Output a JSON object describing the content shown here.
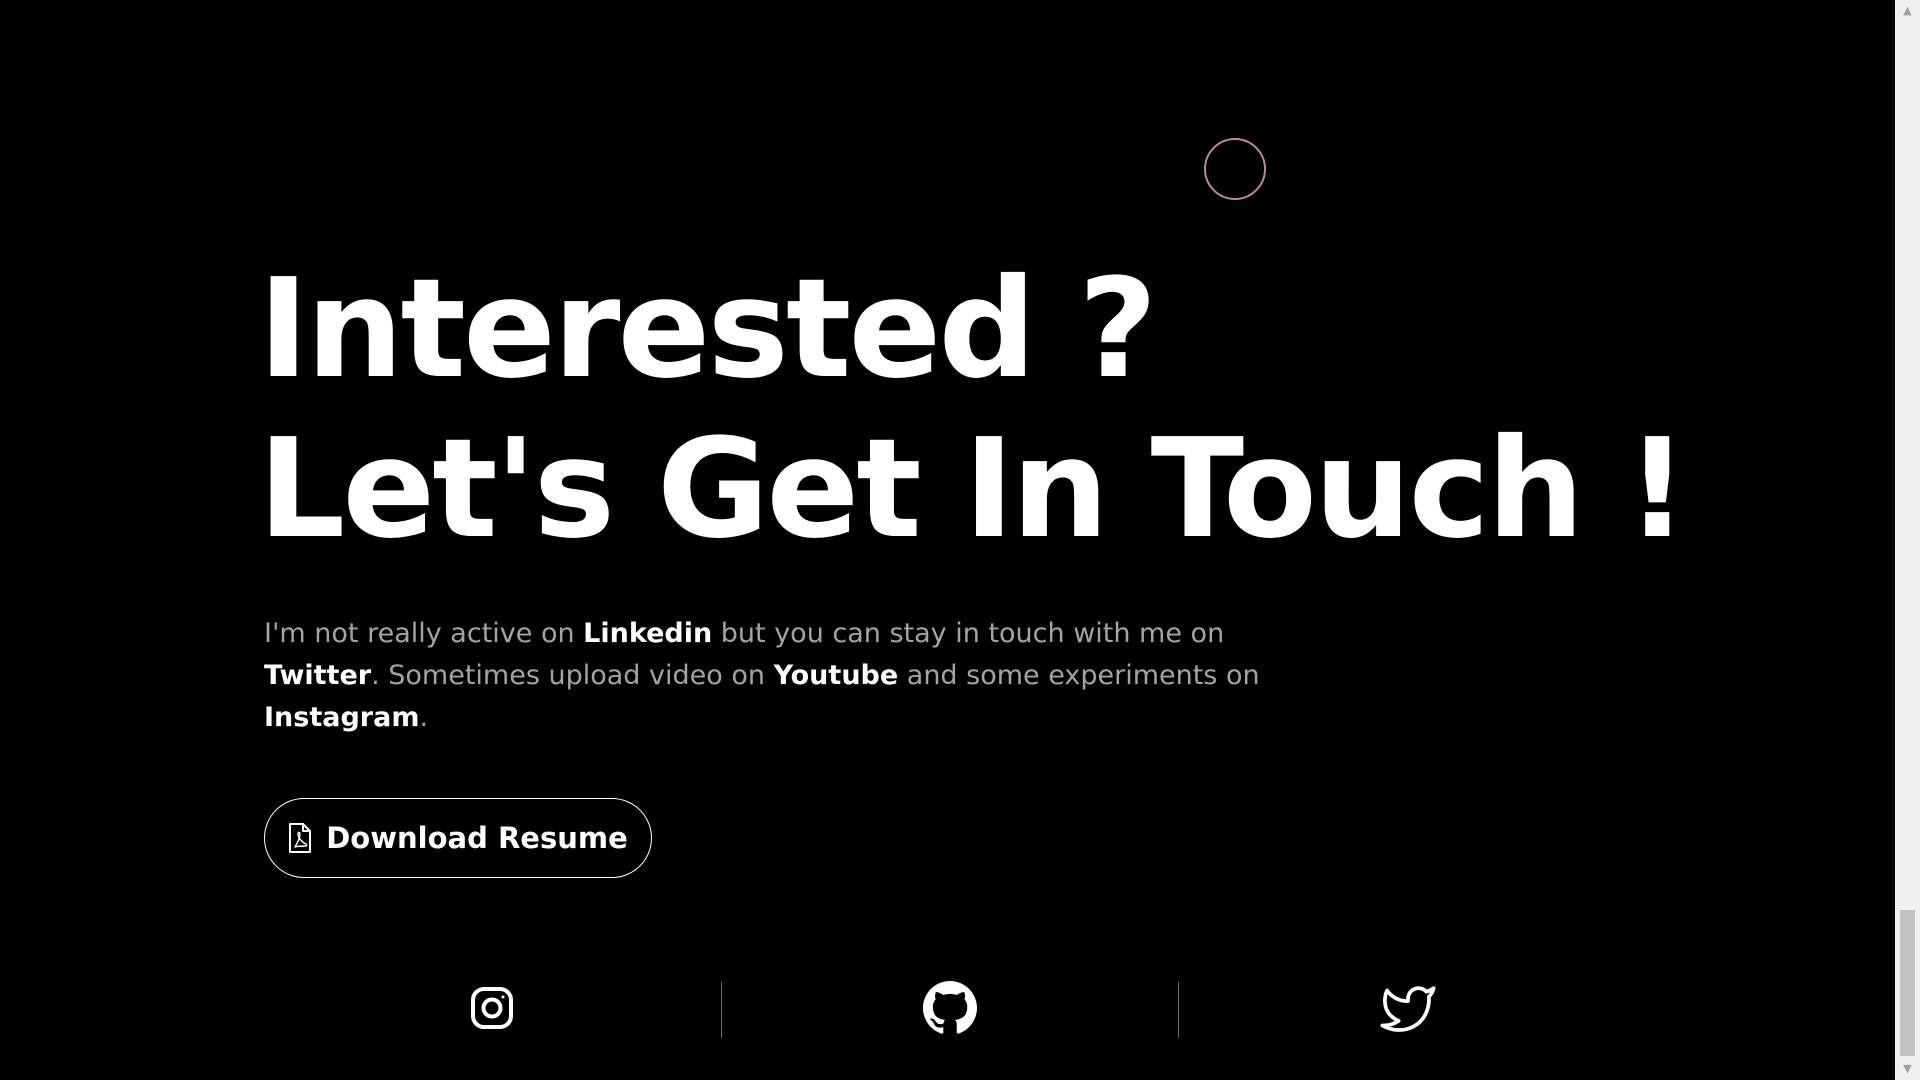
{
  "headline": {
    "line1": "Interested ?",
    "line2": "Let's Get In Touch !"
  },
  "bio": {
    "part1": "I'm not really active on ",
    "link1": "Linkedin",
    "part2": " but you can stay in touch with me on ",
    "link2": "Twitter",
    "part3": ". Sometimes upload video on ",
    "link3": "Youtube",
    "part4": " and some experiments on ",
    "link4": "Instagram",
    "part5": "."
  },
  "resume_button": {
    "label": "Download Resume",
    "icon": "pdf-file-icon"
  },
  "socials": [
    {
      "icon": "instagram-icon"
    },
    {
      "icon": "github-icon"
    },
    {
      "icon": "twitter-icon"
    }
  ],
  "scrollbar": {
    "up_arrow": "▲",
    "down_arrow": "▼"
  },
  "colors": {
    "background": "#000000",
    "text": "#ffffff",
    "muted_text": "#a3a3a3",
    "cursor_ring": "#b88a98",
    "divider": "#6a6a6a"
  }
}
